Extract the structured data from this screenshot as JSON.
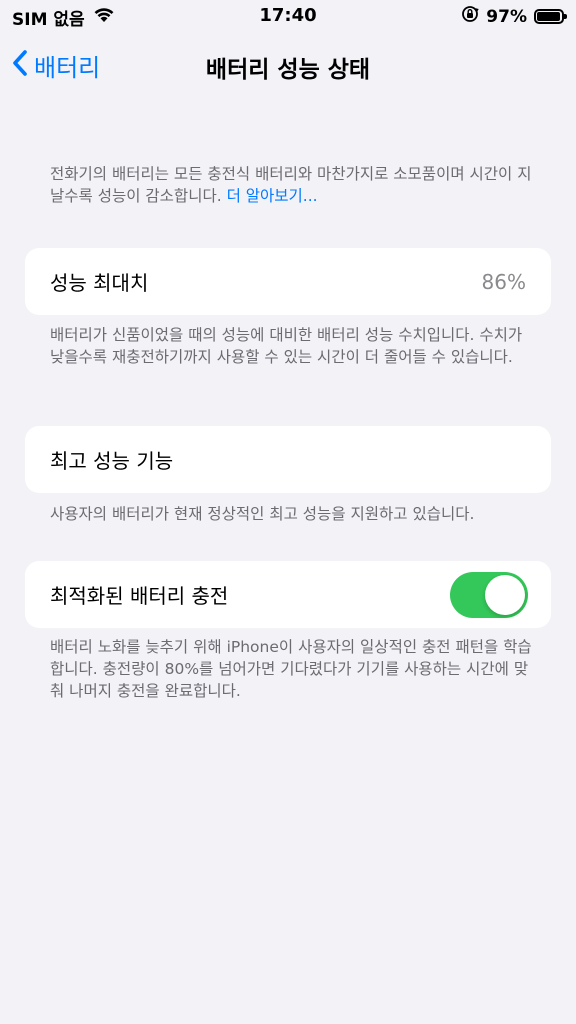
{
  "status_bar": {
    "carrier": "SIM 없음",
    "time": "17:40",
    "battery_percent": "97%",
    "battery_level": 0.97
  },
  "nav": {
    "back_label": "배터리",
    "title": "배터리 성능 상태"
  },
  "intro": {
    "text": "전화기의 배터리는 모든 충전식 배터리와 마찬가지로 소모품이며 시간이 지날수록 성능이 감소합니다. ",
    "link": "더 알아보기..."
  },
  "max_capacity": {
    "label": "성능 최대치",
    "value": "86%",
    "note": "배터리가 신품이었을 때의 성능에 대비한 배터리 성능 수치입니다. 수치가 낮을수록 재충전하기까지 사용할 수 있는 시간이 더 줄어들 수 있습니다."
  },
  "peak_performance": {
    "label": "최고 성능 기능",
    "note": "사용자의 배터리가 현재 정상적인 최고 성능을 지원하고 있습니다."
  },
  "optimized_charging": {
    "label": "최적화된 배터리 충전",
    "enabled": true,
    "note": "배터리 노화를 늦추기 위해 iPhone이 사용자의 일상적인 충전 패턴을 학습합니다. 충전량이 80%를 넘어가면 기다렸다가 기기를 사용하는 시간에 맞춰 나머지 충전을 완료합니다."
  },
  "colors": {
    "accent": "#007aff",
    "toggle_on": "#34c759",
    "background": "#f2f2f7"
  }
}
